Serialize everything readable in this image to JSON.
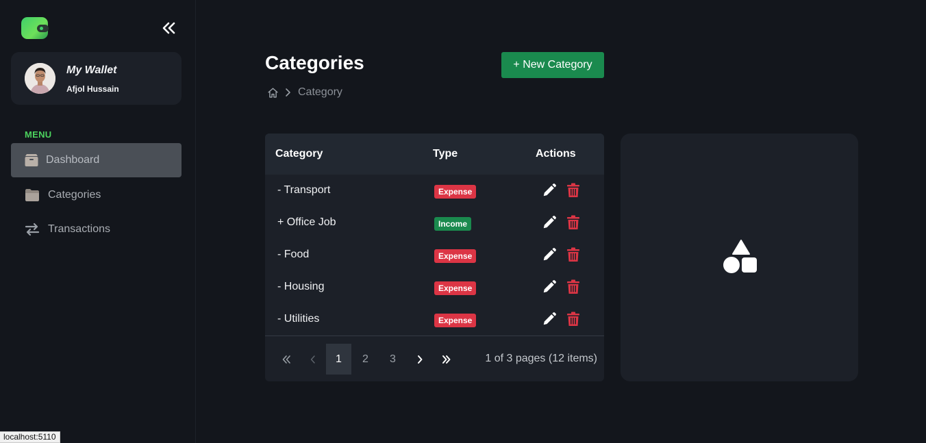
{
  "sidebar": {
    "wallet_name": "My Wallet",
    "user_name": "Afjol Hussain",
    "menu_label": "MENU",
    "items": [
      {
        "label": "Dashboard",
        "icon": "box-icon",
        "active": true
      },
      {
        "label": "Categories",
        "icon": "folder-icon",
        "active": false
      },
      {
        "label": "Transactions",
        "icon": "arrows-exchange-icon",
        "active": false
      }
    ]
  },
  "header": {
    "title": "Categories",
    "new_button_label": "+ New Category",
    "breadcrumb_current": "Category"
  },
  "table": {
    "columns": [
      "Category",
      "Type",
      "Actions"
    ],
    "rows": [
      {
        "category": "- Transport",
        "type": "Expense"
      },
      {
        "category": "+ Office Job",
        "type": "Income"
      },
      {
        "category": "- Food",
        "type": "Expense"
      },
      {
        "category": "- Housing",
        "type": "Expense"
      },
      {
        "category": "- Utilities",
        "type": "Expense"
      }
    ]
  },
  "pagination": {
    "pages": [
      "1",
      "2",
      "3"
    ],
    "current_page": "1",
    "info": "1 of 3 pages (12 items)"
  },
  "status_bar": "localhost:5110",
  "colors": {
    "accent_green": "#1a8a4e",
    "menu_label_green": "#4cd35e",
    "expense_red": "#dc3545",
    "background": "#13161c",
    "card": "#1c2028"
  }
}
